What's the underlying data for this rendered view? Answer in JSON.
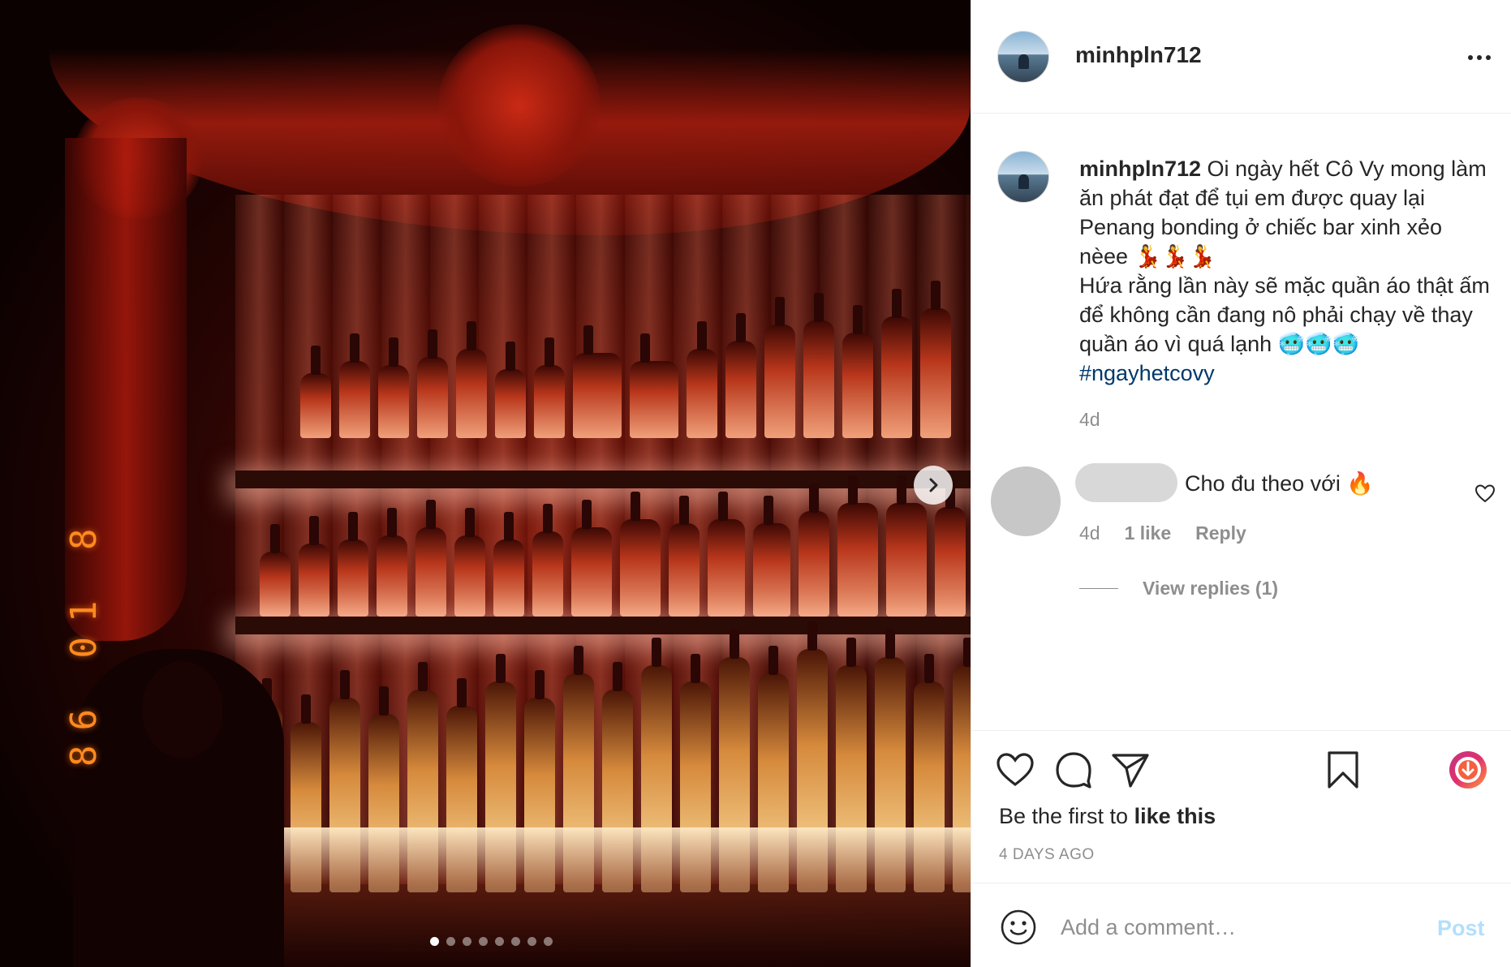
{
  "photo": {
    "datestamp": "86 01 8",
    "next_icon": "chevron-right-icon",
    "carousel_total": 8,
    "carousel_active": 1
  },
  "post": {
    "username": "minhpln712",
    "more_icon": "more-horizontal-icon"
  },
  "caption": {
    "username": "minhpln712",
    "text_line1": " Oi ngày hết Cô Vy mong làm ăn phát đạt để tụi em được quay lại Penang bonding ở chiếc bar xinh xẻo nèee 💃💃💃",
    "text_line2": "Hứa rằng lần này sẽ mặc quần áo thật ấm để không cần đang nô phải chạy về thay quần áo vì quá lạnh 🥶🥶🥶",
    "hashtag": "#ngayhetcovy",
    "time": "4d"
  },
  "comment": {
    "text": "Cho đu theo với 🔥",
    "time": "4d",
    "likes": "1 like",
    "reply_label": "Reply",
    "view_replies": "View replies (1)",
    "heart_icon": "heart-outline-icon"
  },
  "actions": {
    "like_icon": "heart-outline-icon",
    "comment_icon": "comment-bubble-icon",
    "share_icon": "paper-plane-icon",
    "save_icon": "bookmark-icon",
    "download_icon": "download-circle-icon",
    "like_prefix": "Be the first to ",
    "like_bold": "like this",
    "posted_ago": "4 DAYS AGO"
  },
  "comment_box": {
    "placeholder": "Add a comment…",
    "post_label": "Post",
    "emoji_icon": "smiley-icon"
  },
  "colors": {
    "hashtag": "#00376b",
    "secondary_text": "#8e8e8e",
    "post_button_disabled": "#b2dffc",
    "datestamp": "#ff8a1e"
  }
}
